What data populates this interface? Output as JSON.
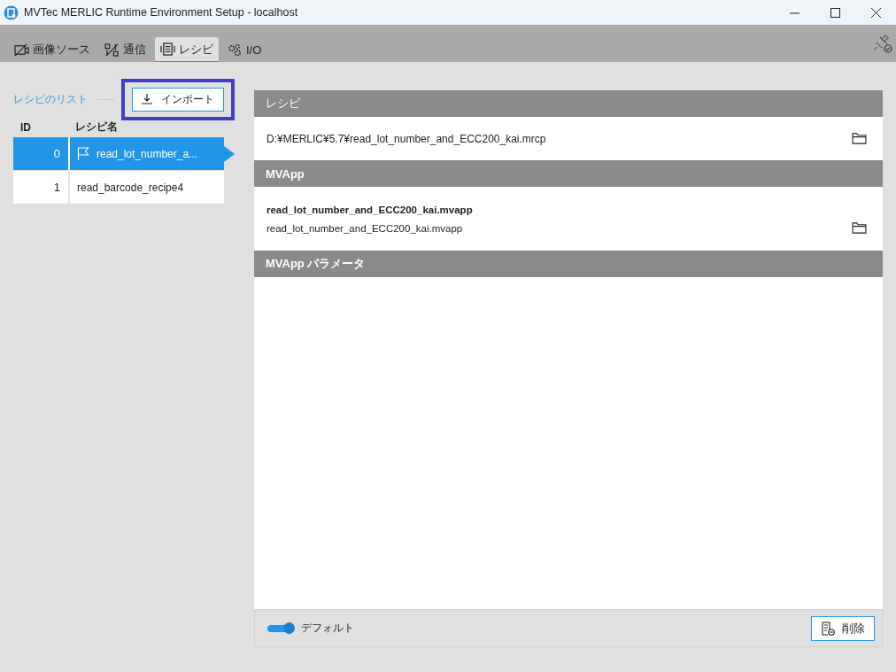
{
  "window": {
    "title": "MVTec MERLIC Runtime Environment Setup - localhost"
  },
  "tabs": [
    {
      "kind": "camera",
      "label": "画像ソース",
      "selected": false
    },
    {
      "kind": "network",
      "label": "通信",
      "selected": false
    },
    {
      "kind": "recipe",
      "label": "レシピ",
      "selected": true
    },
    {
      "kind": "gears",
      "label": "I/O",
      "selected": false
    }
  ],
  "recipe_list": {
    "title": "レシピのリスト",
    "import_button": "インポート",
    "highlighted": true,
    "columns": [
      "ID",
      "レシピ名"
    ],
    "rows": [
      {
        "id": "0",
        "name": "read_lot_number_a...",
        "selected": true,
        "default": true
      },
      {
        "id": "1",
        "name": "read_barcode_recipe4",
        "selected": false,
        "default": false
      }
    ]
  },
  "recipe_section": {
    "header": "レシピ",
    "path": "D:¥MERLIC¥5.7¥read_lot_number_and_ECC200_kai.mrcp"
  },
  "mvapp_section": {
    "header": "MVApp",
    "name": "read_lot_number_and_ECC200_kai.mvapp",
    "file": "read_lot_number_and_ECC200_kai.mvapp"
  },
  "parameters_section": {
    "header": "MVApp パラメータ"
  },
  "footer": {
    "default_toggle": {
      "label": "デフォルト",
      "on": true
    },
    "delete_button": "削除"
  }
}
